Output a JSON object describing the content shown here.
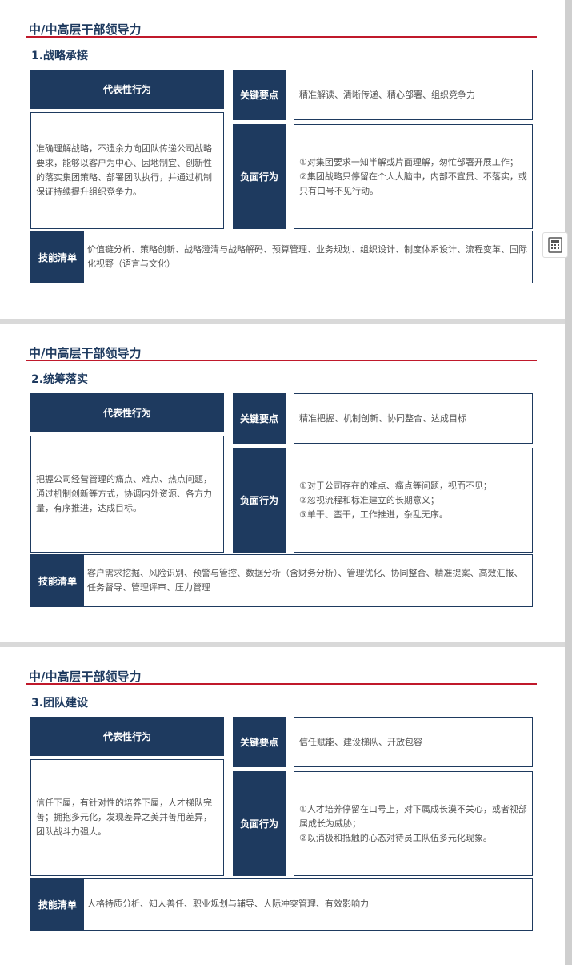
{
  "sections": [
    {
      "title": "中/中高层干部领导力",
      "subtitle": "1.战略承接",
      "behavior_header": "代表性行为",
      "behavior_text": "准确理解战略，不遗余力向团队传递公司战略要求，能够以客户为中心、因地制宜、创新性的落实集团策略、部署团队执行，并通过机制保证持续提升组织竞争力。",
      "key_label": "关键要点",
      "key_text": "精准解读、清晰传递、精心部署、组织竞争力",
      "neg_label": "负面行为",
      "neg_lines": [
        "①对集团要求一知半解或片面理解，匆忙部署开展工作；",
        "②集团战略只停留在个人大脑中，内部不宣贯、不落实，或只有口号不见行动。"
      ],
      "skill_label": "技能清单",
      "skill_text": "价值链分析、策略创新、战略澄清与战略解码、预算管理、业务规划、组织设计、制度体系设计、流程变革、国际化视野（语言与文化）"
    },
    {
      "title": "中/中高层干部领导力",
      "subtitle": "2.统筹落实",
      "behavior_header": "代表性行为",
      "behavior_text": "把握公司经营管理的痛点、难点、热点问题，通过机制创新等方式，协调内外资源、各方力量，有序推进，达成目标。",
      "key_label": "关键要点",
      "key_text": "精准把握、机制创新、协同整合、达成目标",
      "neg_label": "负面行为",
      "neg_lines": [
        "①对于公司存在的难点、痛点等问题，视而不见；",
        "②忽视流程和标准建立的长期意义；",
        "③单干、蛮干，工作推进，杂乱无序。"
      ],
      "skill_label": "技能清单",
      "skill_text": "客户需求挖掘、风险识别、预警与管控、数据分析（含财务分析）、管理优化、协同整合、精准提案、高效汇报、任务督导、管理评审、压力管理"
    },
    {
      "title": "中/中高层干部领导力",
      "subtitle": "3.团队建设",
      "behavior_header": "代表性行为",
      "behavior_text": "信任下属，有针对性的培养下属，人才梯队完善；拥抱多元化，发现差异之美并善用差异，团队战斗力强大。",
      "key_label": "关键要点",
      "key_text": "信任赋能、建设梯队、开放包容",
      "neg_label": "负面行为",
      "neg_lines": [
        "①人才培养停留在口号上，对下属成长漠不关心，或者视部属成长为威胁；",
        "②以消极和抵触的心态对待员工队伍多元化现象。"
      ],
      "skill_label": "技能清单",
      "skill_text": "人格特质分析、知人善任、职业规划与辅导、人际冲突管理、有效影响力"
    }
  ],
  "side_tool": {
    "icon": "calculator-icon"
  },
  "colors": {
    "navy": "#1e3a5f",
    "rule": "#c0192b"
  }
}
